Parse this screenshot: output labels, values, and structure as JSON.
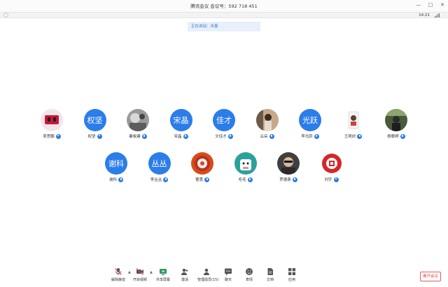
{
  "window": {
    "title": "腾讯会议 会议号：592 718 451"
  },
  "status": {
    "time": "14:21"
  },
  "speaking": {
    "text": "正在讲话：永鑫"
  },
  "participants_row1": [
    {
      "name": "吴思鹏",
      "avatar_text": "",
      "avatar_kind": "photo-red",
      "mic": "user"
    },
    {
      "name": "权坚",
      "avatar_text": "权坚",
      "avatar_kind": "text",
      "mic": "user"
    },
    {
      "name": "秦俊建",
      "avatar_text": "",
      "avatar_kind": "photo-gray",
      "mic": "mic"
    },
    {
      "name": "宋晶",
      "avatar_text": "宋晶",
      "avatar_kind": "text",
      "mic": "mic"
    },
    {
      "name": "文佳才",
      "avatar_text": "佳才",
      "avatar_kind": "text",
      "mic": "mic"
    },
    {
      "name": "云朵",
      "avatar_text": "",
      "avatar_kind": "photo-warm",
      "mic": "mic"
    },
    {
      "name": "李光跃",
      "avatar_text": "光跃",
      "avatar_kind": "text",
      "mic": "mic"
    },
    {
      "name": "王艳欣",
      "avatar_text": "",
      "avatar_kind": "photo-badge",
      "mic": "mic"
    },
    {
      "name": "杨黎婷",
      "avatar_text": "",
      "avatar_kind": "photo-dark",
      "mic": "mic"
    }
  ],
  "participants_row2": [
    {
      "name": "谢科",
      "avatar_text": "谢科",
      "avatar_kind": "text",
      "mic": "mic"
    },
    {
      "name": "李丛丛",
      "avatar_text": "丛丛",
      "avatar_kind": "text",
      "mic": "mic"
    },
    {
      "name": "曹勇",
      "avatar_text": "",
      "avatar_kind": "photo-orange",
      "mic": "mic"
    },
    {
      "name": "毛毛",
      "avatar_text": "",
      "avatar_kind": "photo-teal",
      "mic": "mic"
    },
    {
      "name": "罗德泉",
      "avatar_text": "",
      "avatar_kind": "photo-man",
      "mic": "mic"
    },
    {
      "name": "刘宇",
      "avatar_text": "",
      "avatar_kind": "photo-logo",
      "mic": "user"
    }
  ],
  "toolbar": {
    "unmute": "解除静音",
    "start_video": "开启视频",
    "share_screen": "共享屏幕",
    "invite": "邀请",
    "participants": "管理成员(15)",
    "chat": "聊天",
    "reactions": "表情",
    "docs": "文档",
    "apps": "应用",
    "leave": "离开会议"
  },
  "colors": {
    "accent": "#2b7de9",
    "leave": "#e04040"
  }
}
